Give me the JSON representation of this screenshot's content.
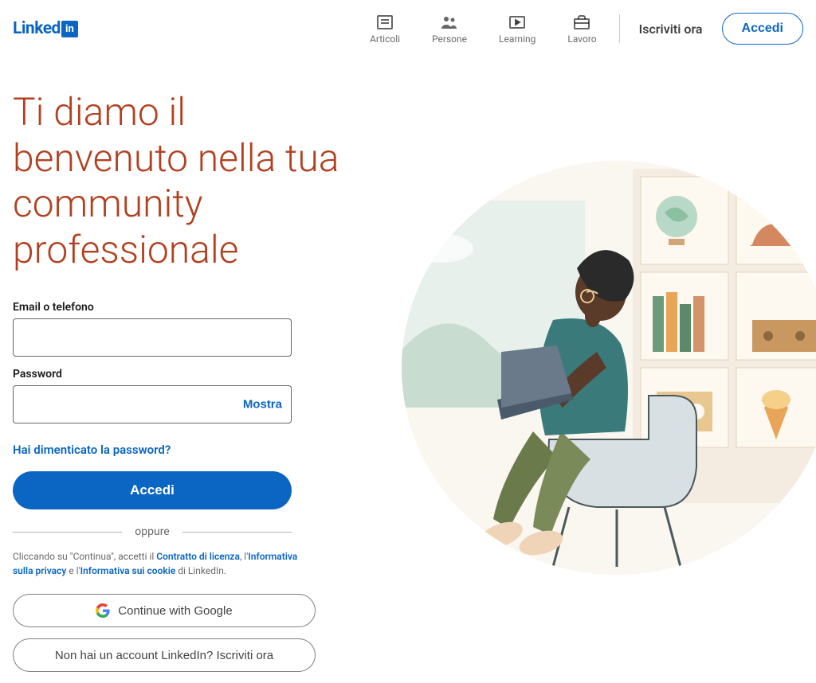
{
  "logo": {
    "text": "Linked",
    "suffix": "in"
  },
  "nav": {
    "items": [
      {
        "label": "Articoli"
      },
      {
        "label": "Persone"
      },
      {
        "label": "Learning"
      },
      {
        "label": "Lavoro"
      }
    ],
    "signup": "Iscriviti ora",
    "signin": "Accedi"
  },
  "hero": {
    "headline": "Ti diamo il benvenuto nella tua community professionale"
  },
  "form": {
    "email_label": "Email o telefono",
    "password_label": "Password",
    "show_password": "Mostra",
    "forgot": "Hai dimenticato la password?",
    "submit": "Accedi",
    "divider": "oppure",
    "legal_prefix": "Cliccando su \"Continua\", accetti il ",
    "legal_contract": "Contratto di licenza",
    "legal_sep1": ", l'",
    "legal_privacy": "Informativa sulla privacy",
    "legal_sep2": " e l'",
    "legal_cookie": "Informativa sui cookie",
    "legal_suffix": " di LinkedIn.",
    "google": "Continue with Google",
    "signup_cta": "Non hai un account LinkedIn? Iscriviti ora"
  }
}
